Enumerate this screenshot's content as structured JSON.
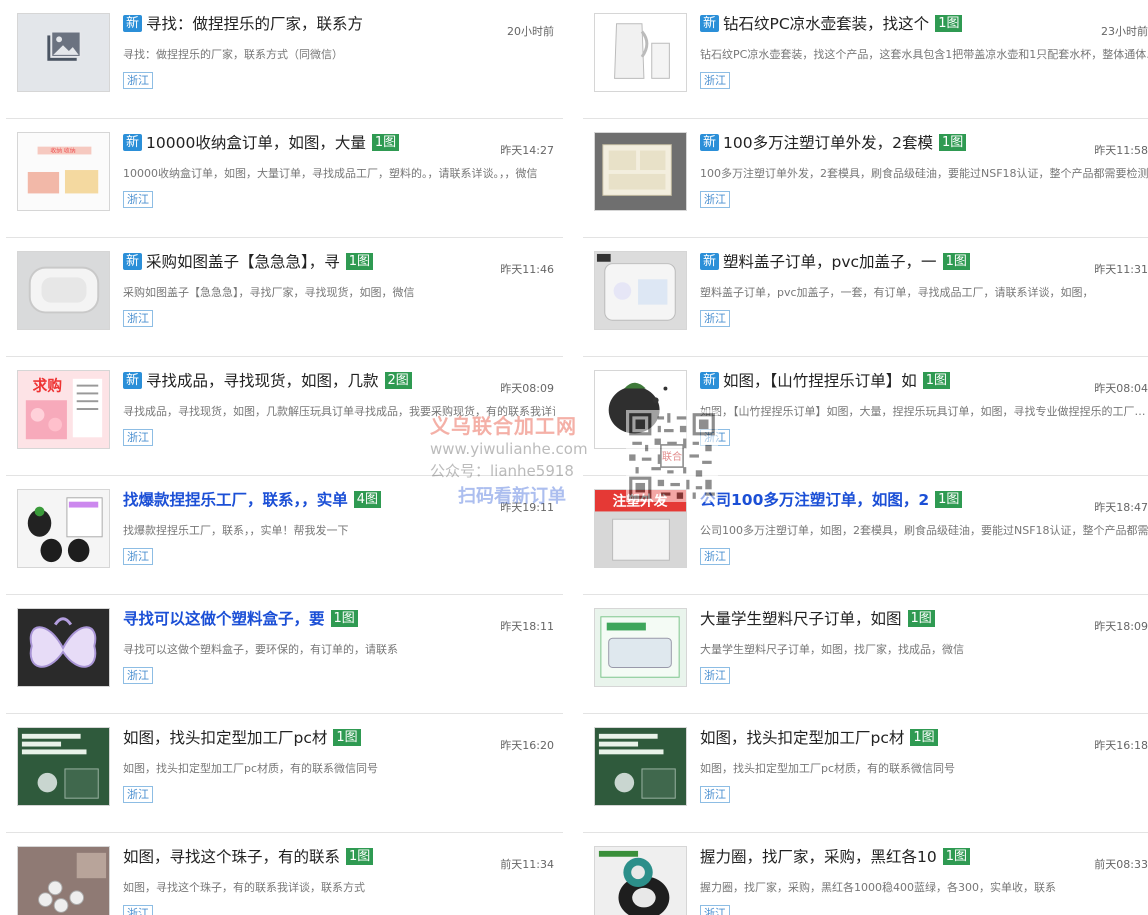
{
  "left_items": [
    {
      "is_new": true,
      "new_label": "新",
      "title": "寻找：做捏捏乐的厂家，联系方",
      "img_count": "",
      "time": "20小时前",
      "desc": "寻找：做捏捏乐的厂家，联系方式（同微信）",
      "location": "浙江",
      "title_style": "normal",
      "thumb": "placeholder"
    },
    {
      "is_new": true,
      "new_label": "新",
      "title": "10000收纳盒订单，如图，大量",
      "img_count": "1图",
      "time": "昨天14:27",
      "desc": "10000收纳盒订单，如图，大量订单，寻找成品工厂，塑料的。，请联系详谈。，，微信",
      "location": "浙江",
      "title_style": "normal",
      "thumb": "storage-box-photo"
    },
    {
      "is_new": true,
      "new_label": "新",
      "title": "采购如图盖子【急急急】，寻",
      "img_count": "1图",
      "time": "昨天11:46",
      "desc": "采购如图盖子【急急急】，寻找厂家，寻找现货，如图，微信",
      "location": "浙江",
      "title_style": "normal",
      "thumb": "white-lid-photo"
    },
    {
      "is_new": true,
      "new_label": "新",
      "title": "寻找成品，寻找现货，如图，几款",
      "img_count": "2图",
      "time": "昨天08:09",
      "desc": "寻找成品，寻找现货，如图，几款解压玩具订单寻找成品，我要采购现货，有的联系我详谈",
      "location": "浙江",
      "title_style": "normal",
      "thumb": "pink-toys-photo"
    },
    {
      "is_new": false,
      "new_label": "",
      "title": "找爆款捏捏乐工厂，联系，，实单",
      "img_count": "4图",
      "time": "昨天19:11",
      "desc": "找爆款捏捏乐工厂，联系，，实单！帮我发一下",
      "location": "浙江",
      "title_style": "blue",
      "thumb": "black-toys-photo"
    },
    {
      "is_new": false,
      "new_label": "",
      "title": "寻找可以这做个塑料盒子，要",
      "img_count": "1图",
      "time": "昨天18:11",
      "desc": "寻找可以这做个塑料盒子，要环保的，有订单的，请联系",
      "location": "浙江",
      "title_style": "blue",
      "thumb": "butterfly-box-photo"
    },
    {
      "is_new": false,
      "new_label": "",
      "title": "如图，找头扣定型加工厂pc材",
      "img_count": "1图",
      "time": "昨天16:20",
      "desc": "如图，找头扣定型加工厂pc材质，有的联系微信同号",
      "location": "浙江",
      "title_style": "normal",
      "thumb": "green-board-photo"
    },
    {
      "is_new": false,
      "new_label": "",
      "title": "如图，寻找这个珠子，有的联系",
      "img_count": "1图",
      "time": "前天11:34",
      "desc": "如图，寻找这个珠子，有的联系我详谈，联系方式",
      "location": "浙江",
      "title_style": "normal",
      "thumb": "beads-photo"
    }
  ],
  "right_items": [
    {
      "is_new": true,
      "new_label": "新",
      "title": "钻石纹PC凉水壶套装，找这个",
      "img_count": "1图",
      "time": "23小时前",
      "desc": "钻石纹PC凉水壶套装，找这个产品，这套水具包含1把带盖凉水壶和1只配套水杯，整体通体…",
      "location": "浙江",
      "title_style": "normal",
      "thumb": "water-jug-photo"
    },
    {
      "is_new": true,
      "new_label": "新",
      "title": "100多万注塑订单外发，2套模",
      "img_count": "1图",
      "time": "昨天11:58",
      "desc": "100多万注塑订单外发，2套模具，刷食品级硅油，要能过NSF18认证，整个产品都需要检测…",
      "location": "浙江",
      "title_style": "normal",
      "thumb": "clear-box-photo"
    },
    {
      "is_new": true,
      "new_label": "新",
      "title": "塑料盖子订单，pvc加盖子，一",
      "img_count": "1图",
      "time": "昨天11:31",
      "desc": "塑料盖子订单，pvc加盖子，一套，有订单，寻找成品工厂，请联系详谈，如图，",
      "location": "浙江",
      "title_style": "normal",
      "thumb": "pvc-lid-photo"
    },
    {
      "is_new": true,
      "new_label": "新",
      "title": "如图，【山竹捏捏乐订单】如",
      "img_count": "1图",
      "time": "昨天08:04",
      "desc": "如图，【山竹捏捏乐订单】如图，大量，捏捏乐玩具订单，如图，寻找专业做捏捏乐的工厂…",
      "location": "浙江",
      "title_style": "normal",
      "thumb": "mangosteen-photo"
    },
    {
      "is_new": false,
      "new_label": "",
      "title": "公司100多万注塑订单，如图，2",
      "img_count": "1图",
      "time": "昨天18:47",
      "desc": "公司100多万注塑订单，如图，2套模具，刷食品级硅油，要能过NSF18认证，整个产品都需…",
      "location": "浙江",
      "title_style": "blue",
      "thumb": "injection-photo"
    },
    {
      "is_new": false,
      "new_label": "",
      "title": "大量学生塑料尺子订单，如图",
      "img_count": "1图",
      "time": "昨天18:09",
      "desc": "大量学生塑料尺子订单，如图，找厂家，找成品，微信",
      "location": "浙江",
      "title_style": "normal",
      "thumb": "ruler-photo"
    },
    {
      "is_new": false,
      "new_label": "",
      "title": "如图，找头扣定型加工厂pc材",
      "img_count": "1图",
      "time": "昨天16:18",
      "desc": "如图，找头扣定型加工厂pc材质，有的联系微信同号",
      "location": "浙江",
      "title_style": "normal",
      "thumb": "green-board-photo"
    },
    {
      "is_new": false,
      "new_label": "",
      "title": "握力圈，找厂家，采购，黑红各10",
      "img_count": "1图",
      "time": "前天08:33",
      "desc": "握力圈，找厂家，采购，黑红各1000稳400蓝绿，各300，实单收，联系",
      "location": "浙江",
      "title_style": "normal",
      "thumb": "grip-ring-photo"
    }
  ],
  "watermark": {
    "name": "义乌联合加工网",
    "url": "www.yiwulianhe.com",
    "wechat": "公众号：lianhe5918",
    "slogan": "扫码看新订单",
    "qr_label": "联合"
  },
  "thumb_text": {
    "pink-toys-photo": "求购",
    "injection-photo": "注塑外发"
  }
}
